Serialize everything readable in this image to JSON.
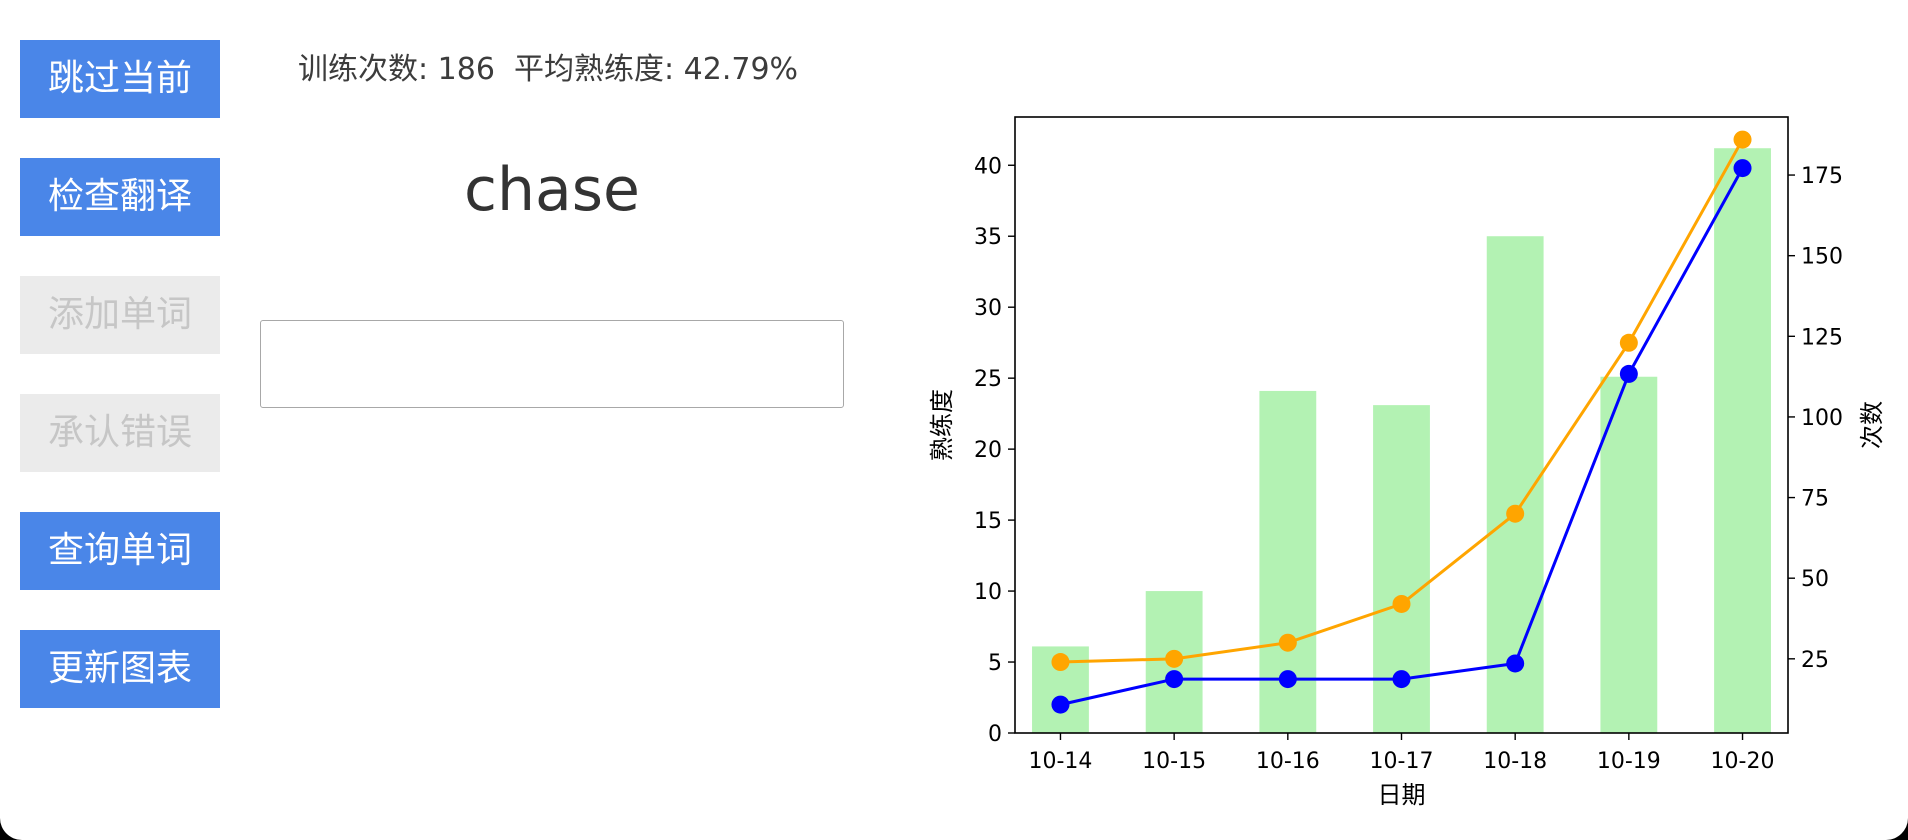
{
  "buttons": {
    "skip": "跳过当前",
    "check": "检查翻译",
    "add": "添加单词",
    "admit": "承认错误",
    "lookup": "查询单词",
    "refresh": "更新图表"
  },
  "stats": {
    "count_label": "训练次数:",
    "count_value": "186",
    "avg_label": "平均熟练度:",
    "avg_value": "42.79%"
  },
  "current_word": "chase",
  "answer_input": {
    "value": "",
    "placeholder": ""
  },
  "chart_data": {
    "type": "bar",
    "categories": [
      "10-14",
      "10-15",
      "10-16",
      "10-17",
      "10-18",
      "10-19",
      "10-20"
    ],
    "xlabel": "日期",
    "ylabel": "熟练度",
    "ylabel_right": "次数",
    "ylim": [
      0,
      43.4
    ],
    "ylim_right": [
      2,
      193
    ],
    "yticks": [
      0,
      5,
      10,
      15,
      20,
      25,
      30,
      35,
      40
    ],
    "yticks_right": [
      25,
      50,
      75,
      100,
      125,
      150,
      175
    ],
    "colors": {
      "bars": "#b3f2b3",
      "proficiency_line": "#0000ff",
      "count_line": "#ffa500"
    },
    "series": [
      {
        "type": "bar",
        "axis": "left",
        "values": [
          6.1,
          10.0,
          24.1,
          23.1,
          35.0,
          25.1,
          41.2
        ]
      },
      {
        "type": "line",
        "axis": "left",
        "values": [
          2.0,
          3.8,
          3.8,
          3.8,
          4.9,
          25.3,
          39.8
        ]
      },
      {
        "type": "line",
        "axis": "right",
        "values": [
          24,
          25,
          30,
          42,
          70,
          123,
          186
        ]
      }
    ],
    "grid": false,
    "legend": "none"
  }
}
